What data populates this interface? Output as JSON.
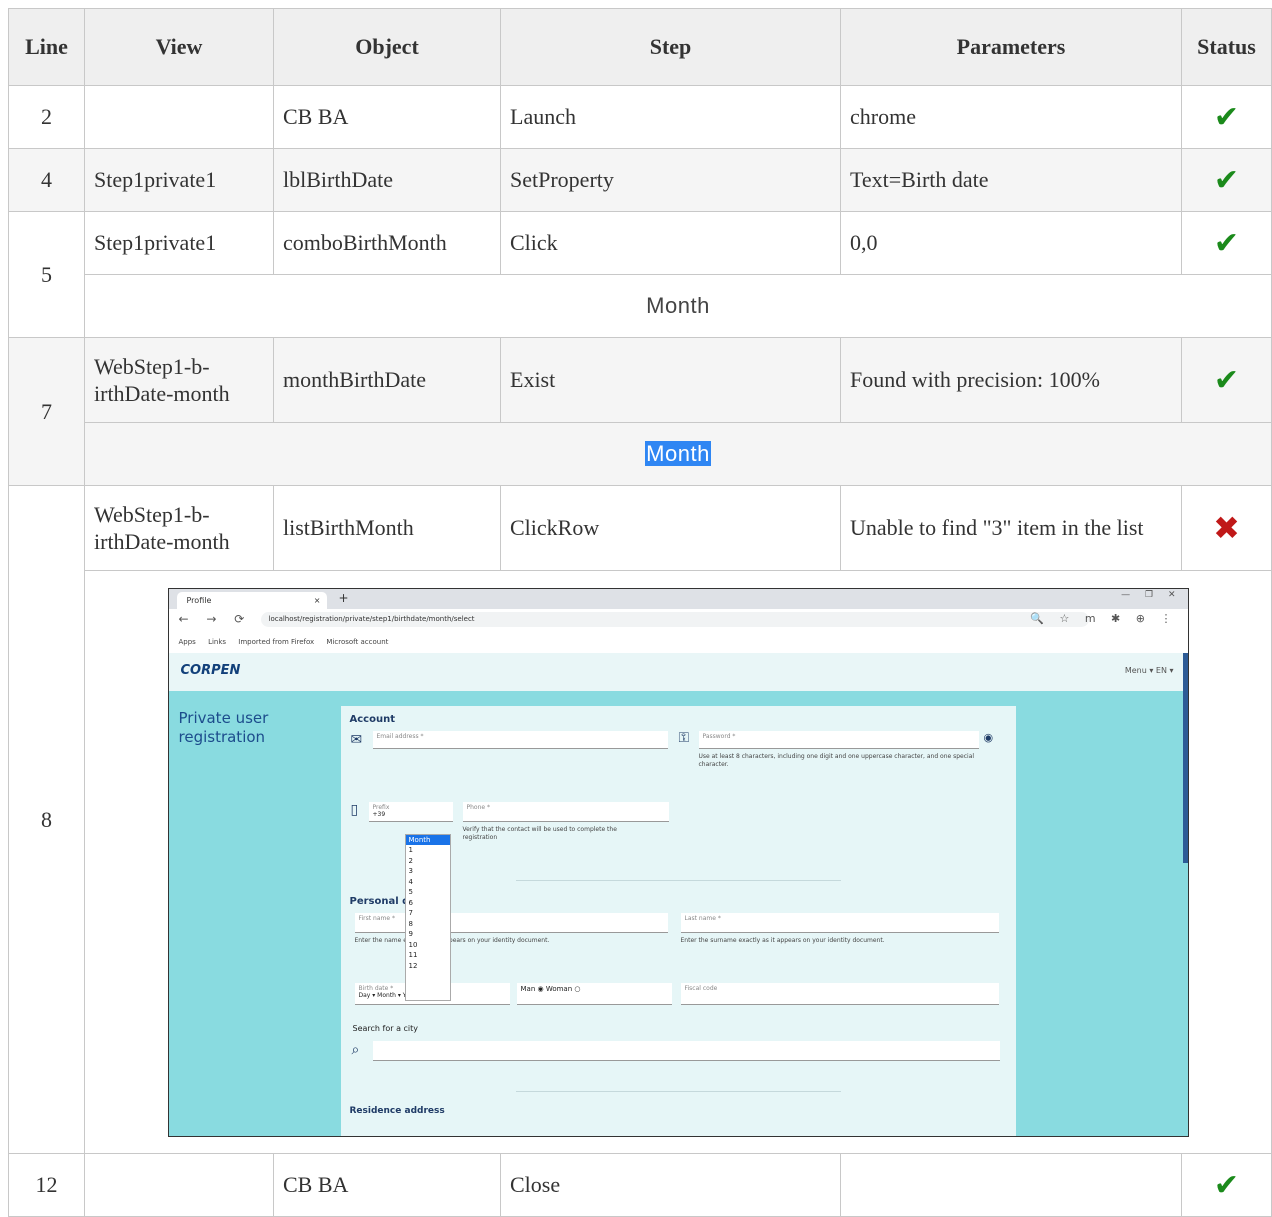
{
  "headers": {
    "line": "Line",
    "view": "View",
    "object": "Object",
    "step": "Step",
    "parameters": "Parameters",
    "status": "Status"
  },
  "rows": [
    {
      "line": "2",
      "view": "",
      "object": "CB BA",
      "step": "Launch",
      "parameters": "chrome",
      "status": "pass"
    },
    {
      "line": "4",
      "view": "Step1private1",
      "object": "lblBirthDate",
      "step": "SetProperty",
      "parameters": "Text=Birth date",
      "status": "pass"
    },
    {
      "line": "5",
      "view": "Step1private1",
      "object": "comboBirthMonth",
      "step": "Click",
      "parameters": "0,0",
      "status": "pass",
      "snapshot_text": "Month"
    },
    {
      "line": "7",
      "view": "WebStep1-b-irthDate-month",
      "object": "monthBirthDate",
      "step": "Exist",
      "parameters": "Found with precision: 100%",
      "status": "pass",
      "snapshot_text": "Month"
    },
    {
      "line": "8",
      "view": "WebStep1-b-irthDate-month",
      "object": "listBirthMonth",
      "step": "ClickRow",
      "parameters": "Unable to find \"3\" item in the list",
      "status": "fail"
    },
    {
      "line": "12",
      "view": "",
      "object": "CB BA",
      "step": "Close",
      "parameters": "",
      "status": "pass"
    }
  ],
  "icons": {
    "pass": "check-icon",
    "fail": "cross-icon",
    "pass_glyph": "✔",
    "fail_glyph": "✖"
  },
  "colors": {
    "pass": "#1b8a1b",
    "fail": "#c01818",
    "highlight": "#2f86f3"
  },
  "screenshot": {
    "tab_title": "Profile",
    "tab_close": "×",
    "new_tab": "+",
    "window_controls": "— ❐ ✕",
    "nav_buttons": "← → ⟳ ⌂",
    "url": "localhost/registration/private/step1/birthdate/month/select",
    "ext_icons": "🔍 ☆ m ✱ ⊕ ⋮",
    "bookmarks": [
      "Apps",
      "Links",
      "Imported from Firefox",
      "Microsoft account"
    ],
    "logo": "CORPEN",
    "lang": "Menu ▾  EN ▾",
    "side_title": "Private user registration",
    "account_label": "Account",
    "email_placeholder": "Email address *",
    "password_placeholder": "Password *",
    "password_hint": "Use at least 8 characters, including one digit and one uppercase character, and one special character.",
    "prefix_label": "Prefix",
    "prefix_value": "+39",
    "phone_placeholder": "Phone *",
    "phone_hint": "Verify that the contact will be used to complete the registration",
    "personal_label": "Personal data",
    "firstname_placeholder": "First name *",
    "lastname_placeholder": "Last name *",
    "name_hint": "Enter the name exactly as it appears on your identity document.",
    "surname_hint": "Enter the surname exactly as it appears on your identity document.",
    "birth_label": "Birth date *",
    "birth_value": "Day ▾  Month ▾  Year ▾",
    "gender_value": "Man ◉  Woman ○",
    "fiscal_placeholder": "Fiscal code",
    "city_label": "Search for a city",
    "residence_label": "Residence address",
    "month_options": [
      "Month",
      "1",
      "2",
      "3",
      "4",
      "5",
      "6",
      "7",
      "8",
      "9",
      "10",
      "11",
      "12"
    ]
  }
}
